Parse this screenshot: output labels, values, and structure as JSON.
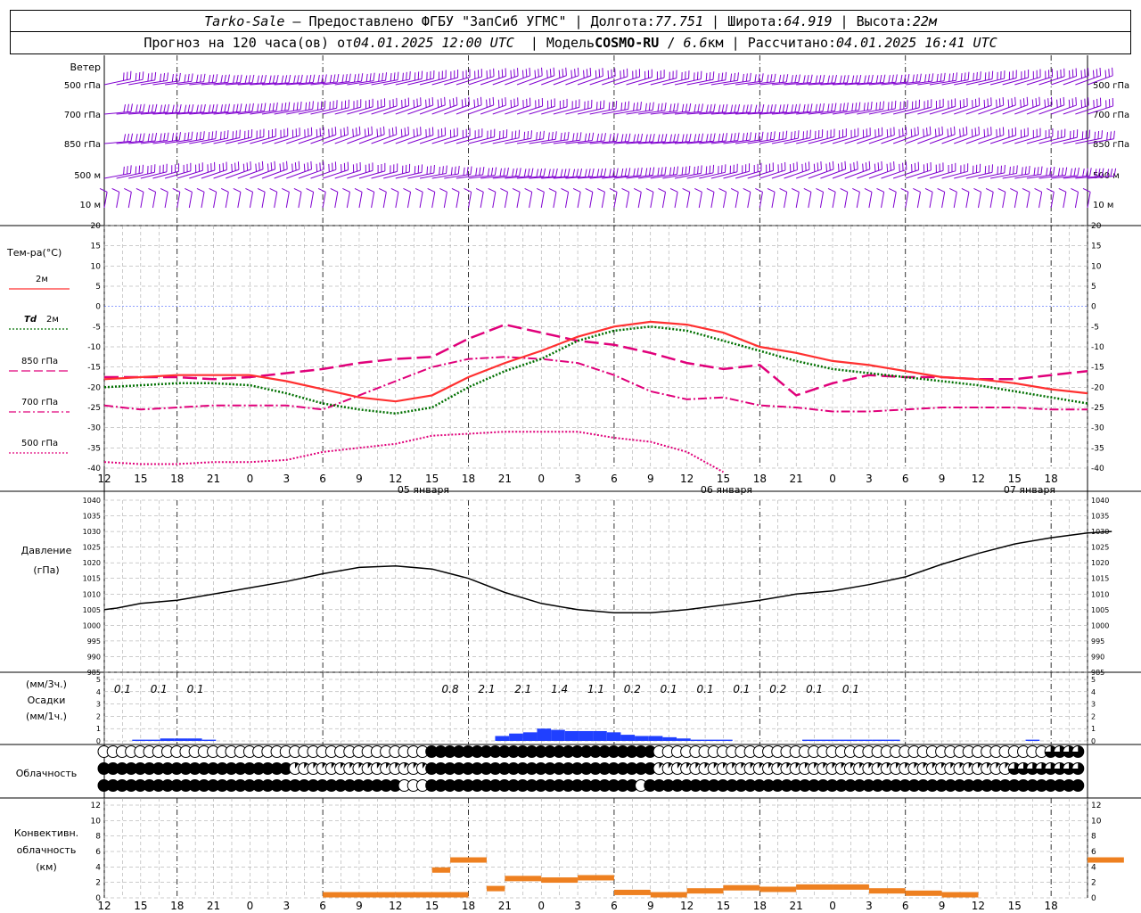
{
  "header": {
    "station": "Tarko-Sale",
    "dash": " – ",
    "provider": "Предоставлено ФГБУ \"ЗапСиб УГМС\"",
    "lon_label": "Долгота:",
    "lon_value": "77.751",
    "lat_label": "Широта:",
    "lat_value": "64.919",
    "alt_label": "Высота:",
    "alt_value": "22м",
    "forecast_prefix": "Прогноз на 120 часа(ов) от",
    "forecast_time": "04.01.2025 12:00 UTC",
    "model_label": "Модель",
    "model_name": "COSMO-RU",
    "model_res_sep": " / ",
    "model_res": "6.6",
    "model_res_unit": "км",
    "calc_label": "Рассчитано:",
    "calc_time": "04.01.2025 16:41 UTC"
  },
  "x_axis": {
    "ticks": [
      "12",
      "15",
      "18",
      "21",
      "0",
      "3",
      "6",
      "9",
      "12",
      "15",
      "18",
      "21",
      "0",
      "3",
      "6",
      "9",
      "12",
      "15",
      "18",
      "21",
      "0",
      "3",
      "6",
      "9",
      "12",
      "15",
      "18"
    ],
    "dates": [
      "05 января",
      "06 января",
      "07 января"
    ]
  },
  "wind_panel": {
    "title": "Ветер",
    "levels": [
      "500 гПа",
      "700 гПа",
      "850 гПа",
      "500 м",
      "10 м"
    ]
  },
  "temp_panel": {
    "title": "Тем-ра(°С)",
    "legend": [
      {
        "label": "2м",
        "color": "#ff3030",
        "style": "solid"
      },
      {
        "label": "Td",
        "label2": "2м",
        "color": "#007000",
        "style": "dotted"
      },
      {
        "label": "850 гПа",
        "color": "#e0007a",
        "style": "dashed"
      },
      {
        "label": "700 гПа",
        "color": "#e0007a",
        "style": "dashdot"
      },
      {
        "label": "500 гПа",
        "color": "#e0007a",
        "style": "dotted"
      }
    ],
    "yticks": [
      "20",
      "15",
      "10",
      "5",
      "0",
      "-5",
      "-10",
      "-15",
      "-20",
      "-25",
      "-30",
      "-35",
      "-40"
    ]
  },
  "pressure_panel": {
    "title": "Давление",
    "unit": "(гПа)",
    "yticks": [
      "1040",
      "1035",
      "1030",
      "1025",
      "1020",
      "1015",
      "1010",
      "1005",
      "1000",
      "995",
      "990",
      "985"
    ]
  },
  "precip_panel": {
    "unit3": "(мм/3ч.)",
    "title": "Осадки",
    "unit1": "(мм/1ч.)",
    "yticks": [
      "5",
      "4",
      "3",
      "2",
      "1",
      "0"
    ],
    "labels": [
      {
        "t": 3,
        "v": "0.1"
      },
      {
        "t": 9,
        "v": "0.1"
      },
      {
        "t": 15,
        "v": "0.1"
      },
      {
        "t": 57,
        "v": "0.8"
      },
      {
        "t": 63,
        "v": "2.1"
      },
      {
        "t": 69,
        "v": "2.1"
      },
      {
        "t": 75,
        "v": "1.4"
      },
      {
        "t": 81,
        "v": "1.1"
      },
      {
        "t": 87,
        "v": "0.2"
      },
      {
        "t": 93,
        "v": "0.1"
      },
      {
        "t": 99,
        "v": "0.1"
      },
      {
        "t": 105,
        "v": "0.1"
      },
      {
        "t": 111,
        "v": "0.2"
      },
      {
        "t": 117,
        "v": "0.1"
      },
      {
        "t": 123,
        "v": "0.1"
      }
    ]
  },
  "cloud_panel": {
    "title": "Облачность"
  },
  "conv_panel": {
    "title1": "Конвективн.",
    "title2": "облачность",
    "unit": "(км)",
    "yticks": [
      "12",
      "10",
      "8",
      "6",
      "4",
      "2",
      "0"
    ]
  },
  "colors": {
    "wind": "#8000d0",
    "t2m": "#ff3030",
    "td": "#007000",
    "upper": "#e0007a",
    "precip": "#2040ff",
    "conv": "#ee8020",
    "zero_line": "#2040ff",
    "grid": "#999999"
  },
  "chart_data": {
    "type": "line",
    "x_hours": [
      0,
      6,
      12,
      18,
      24,
      30,
      36,
      42,
      48,
      54,
      60,
      66,
      72,
      78,
      84,
      90,
      96,
      102,
      108,
      114,
      120,
      126,
      132,
      138,
      144,
      150,
      156,
      162
    ],
    "t2m": [
      -18,
      -17.5,
      -17,
      -17,
      -17,
      -18.5,
      -20.5,
      -22.5,
      -23.5,
      -22,
      -17.5,
      -14,
      -11,
      -7.5,
      -5,
      -3.8,
      -4.5,
      -6.5,
      -10,
      -11.5,
      -13.5,
      -14.5,
      -16,
      -17.5,
      -18,
      -19,
      -20.5,
      -21.5
    ],
    "td2m": [
      -20,
      -19.5,
      -19,
      -19,
      -19.5,
      -21.5,
      -24,
      -25.5,
      -26.5,
      -25,
      -20,
      -16,
      -13,
      -8.5,
      -6,
      -5,
      -6,
      -8.5,
      -11,
      -13.5,
      -15.5,
      -16.5,
      -17.5,
      -18.5,
      -19.5,
      -21,
      -22.5,
      -24
    ],
    "t850": [
      -17.5,
      -17.5,
      -17.5,
      -18,
      -17.5,
      -16.5,
      -15.5,
      -14,
      -13,
      -12.5,
      -8,
      -4.5,
      -6.5,
      -8.5,
      -9.5,
      -11.5,
      -14,
      -15.5,
      -14.5,
      -22,
      -19,
      -17,
      -17.5,
      -17.5,
      -18,
      -18,
      -17,
      -16
    ],
    "t700": [
      -24.5,
      -25.5,
      -25,
      -24.5,
      -24.5,
      -24.5,
      -25.5,
      -22,
      -18.5,
      -15,
      -13,
      -12.5,
      -13,
      -14,
      -17,
      -21,
      -23,
      -22.5,
      -24.5,
      -25,
      -26,
      -26,
      -25.5,
      -25,
      -25,
      -25,
      -25.5,
      -25.5
    ],
    "t500": [
      -38.5,
      -39,
      -39,
      -38.5,
      -38.5,
      -38,
      -36,
      -35,
      -34,
      -32,
      -31.5,
      -31,
      -31,
      -31,
      -32.5,
      -33.5,
      -36,
      -41
    ],
    "t500_x": [
      0,
      6,
      12,
      18,
      24,
      30,
      36,
      42,
      48,
      54,
      60,
      66,
      72,
      78,
      84,
      90,
      96,
      102
    ],
    "pressure": [
      1005,
      1005.5,
      1007,
      1008,
      1010,
      1012,
      1014,
      1016.5,
      1018.5,
      1019,
      1018,
      1015,
      1010.5,
      1007,
      1005,
      1004,
      1004,
      1005,
      1006.5,
      1008,
      1010,
      1011,
      1013,
      1015.5,
      1019.5,
      1023,
      1026,
      1028,
      1029.5,
      1030
    ],
    "pressure_x": [
      0,
      2,
      6,
      12,
      18,
      24,
      30,
      36,
      42,
      48,
      54,
      60,
      66,
      72,
      78,
      84,
      90,
      96,
      102,
      108,
      114,
      120,
      126,
      132,
      138,
      144,
      150,
      156,
      162,
      166
    ],
    "precip_1h": [
      0,
      0,
      0.1,
      0.1,
      0.2,
      0.2,
      0.2,
      0.1,
      0,
      0,
      0,
      0,
      0,
      0,
      0,
      0,
      0,
      0,
      0,
      0,
      0,
      0,
      0,
      0,
      0,
      0,
      0,
      0,
      0.4,
      0.6,
      0.7,
      1.0,
      0.9,
      0.8,
      0.8,
      0.8,
      0.7,
      0.5,
      0.4,
      0.4,
      0.3,
      0.2,
      0.1,
      0.1,
      0.1,
      0,
      0,
      0,
      0,
      0,
      0.1,
      0.1,
      0.1,
      0.1,
      0.1,
      0.1,
      0.1,
      0,
      0,
      0,
      0,
      0,
      0,
      0,
      0,
      0,
      0.1,
      0,
      0,
      0
    ],
    "clouds_high": [
      0,
      0,
      0,
      0,
      0,
      0,
      0,
      0,
      0,
      0,
      0,
      0,
      0,
      0,
      0,
      0,
      0,
      0,
      0,
      0,
      0,
      0,
      0,
      0,
      0,
      0,
      0,
      0,
      0,
      0,
      0,
      0,
      0,
      0,
      0,
      0,
      0,
      0,
      0,
      0,
      0,
      0,
      0,
      0,
      0,
      0,
      0,
      0,
      0,
      0,
      0,
      0,
      0,
      0,
      0,
      0,
      0,
      0,
      0,
      0,
      0,
      0,
      0,
      0,
      0,
      0,
      0,
      0,
      0,
      0,
      0,
      0,
      0,
      0,
      0,
      0,
      0,
      0,
      0,
      0,
      0,
      0,
      0,
      0,
      0,
      0,
      0,
      0,
      0,
      0,
      0,
      0,
      0,
      0,
      0,
      0,
      0,
      0,
      0,
      0,
      0,
      0,
      0,
      0,
      0,
      0,
      0,
      0,
      0,
      0,
      0,
      0,
      0,
      0,
      0,
      0,
      0,
      0,
      0,
      0,
      0,
      0,
      0,
      0,
      0,
      0,
      0,
      0,
      0,
      0,
      0,
      0,
      0,
      0,
      0,
      0,
      0,
      0,
      0,
      0,
      0,
      0,
      0,
      0,
      0,
      0,
      0,
      0,
      0,
      0,
      0,
      0,
      0,
      0,
      0,
      0,
      0,
      0,
      0,
      0,
      0,
      0,
      0,
      0,
      0,
      0,
      0,
      0,
      0,
      0,
      0,
      0,
      0,
      0,
      0,
      0,
      0,
      0,
      0,
      0,
      0,
      0
    ],
    "conv_tops": [
      {
        "t0": 36,
        "t1": 48,
        "top": 0.4
      },
      {
        "t0": 48,
        "t1": 60,
        "top": 0.4
      },
      {
        "t0": 54,
        "t1": 57,
        "top": 3.6
      },
      {
        "t0": 57,
        "t1": 63,
        "top": 4.9
      },
      {
        "t0": 63,
        "t1": 66,
        "top": 1.2
      },
      {
        "t0": 66,
        "t1": 72,
        "top": 2.5
      },
      {
        "t0": 72,
        "t1": 78,
        "top": 2.3
      },
      {
        "t0": 78,
        "t1": 84,
        "top": 2.6
      },
      {
        "t0": 84,
        "t1": 90,
        "top": 0.7
      },
      {
        "t0": 90,
        "t1": 96,
        "top": 0.4
      },
      {
        "t0": 96,
        "t1": 102,
        "top": 0.9
      },
      {
        "t0": 102,
        "t1": 108,
        "top": 1.3
      },
      {
        "t0": 108,
        "t1": 114,
        "top": 1.1
      },
      {
        "t0": 114,
        "t1": 120,
        "top": 1.4
      },
      {
        "t0": 120,
        "t1": 126,
        "top": 1.4
      },
      {
        "t0": 126,
        "t1": 132,
        "top": 0.9
      },
      {
        "t0": 132,
        "t1": 138,
        "top": 0.6
      },
      {
        "t0": 138,
        "t1": 144,
        "top": 0.4
      },
      {
        "t0": 162,
        "t1": 168,
        "top": 4.9
      }
    ],
    "ylim_temp": [
      -40,
      20
    ],
    "ylim_pressure": [
      985,
      1040
    ],
    "ylim_precip": [
      0,
      5
    ],
    "ylim_conv": [
      0,
      12
    ]
  }
}
